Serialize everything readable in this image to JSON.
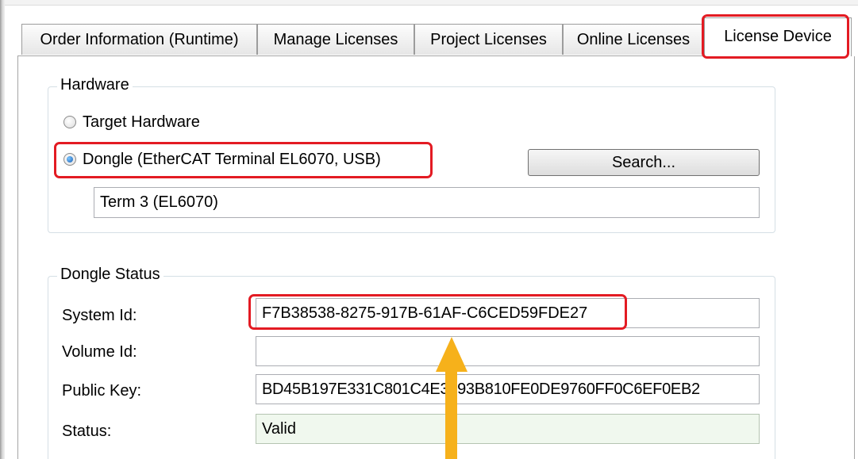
{
  "tabs": [
    {
      "label": "Order Information (Runtime)",
      "active": false
    },
    {
      "label": "Manage Licenses",
      "active": false
    },
    {
      "label": "Project Licenses",
      "active": false
    },
    {
      "label": "Online Licenses",
      "active": false
    },
    {
      "label": "License Device",
      "active": true
    }
  ],
  "hardware": {
    "title": "Hardware",
    "radio_target": "Target Hardware",
    "radio_dongle": "Dongle (EtherCAT Terminal EL6070, USB)",
    "selected": "dongle",
    "search_button": "Search...",
    "device_value": "Term 3 (EL6070)"
  },
  "dongle_status": {
    "title": "Dongle Status",
    "system_id_label": "System Id:",
    "system_id_value": "F7B38538-8275-917B-61AF-C6CED59FDE27",
    "volume_id_label": "Volume Id:",
    "volume_id_value": "",
    "public_key_label": "Public Key:",
    "public_key_value": "BD45B197E331C801C4E3893B810FE0DE9760FF0C6EF0EB2",
    "status_label": "Status:",
    "status_value": "Valid"
  },
  "colors": {
    "highlight": "#e31b23",
    "arrow": "#f6b11b",
    "valid_background": "#f0f8ee",
    "radio_selected": "#1a5fb4"
  },
  "icons": {
    "annotation_arrow": "up-arrow-icon"
  }
}
